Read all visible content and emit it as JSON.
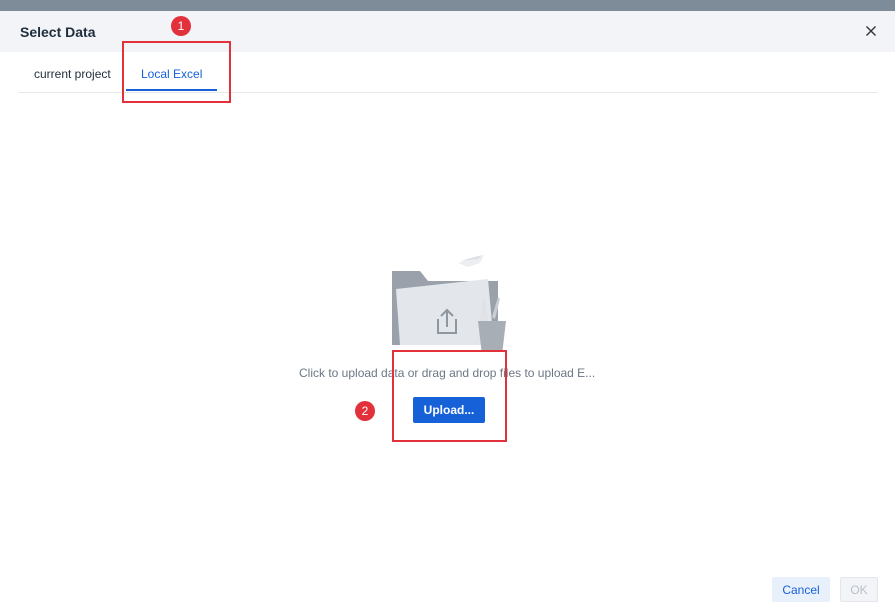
{
  "dialog": {
    "title": "Select Data",
    "close_icon": "close-icon"
  },
  "tabs": [
    {
      "label": "current project",
      "active": false
    },
    {
      "label": "Local Excel",
      "active": true
    }
  ],
  "upload": {
    "hint": "Click to upload data or drag and drop files to upload E...",
    "button_label": "Upload...",
    "illustration_icon": "folder-upload-icon"
  },
  "callouts": [
    "1",
    "2"
  ],
  "footer": {
    "cancel_label": "Cancel",
    "ok_label": "OK"
  },
  "colors": {
    "accent": "#1661d8",
    "callout": "#e2313b",
    "header_bg": "#f2f4f7"
  }
}
